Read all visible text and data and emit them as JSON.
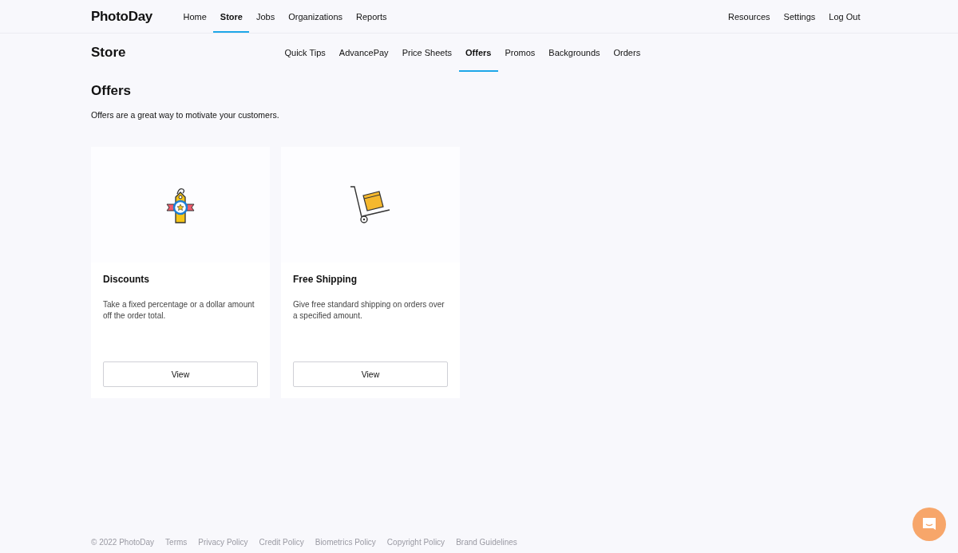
{
  "logo": "PhotoDay",
  "nav": [
    {
      "label": "Home",
      "selected": false
    },
    {
      "label": "Store",
      "selected": true
    },
    {
      "label": "Jobs",
      "selected": false
    },
    {
      "label": "Organizations",
      "selected": false
    },
    {
      "label": "Reports",
      "selected": false
    }
  ],
  "nav_right": [
    "Resources",
    "Settings",
    "Log Out"
  ],
  "section_title": "Store",
  "subnav": [
    {
      "label": "Quick Tips",
      "selected": false
    },
    {
      "label": "AdvancePay",
      "selected": false
    },
    {
      "label": "Price Sheets",
      "selected": false
    },
    {
      "label": "Offers",
      "selected": true
    },
    {
      "label": "Promos",
      "selected": false
    },
    {
      "label": "Backgrounds",
      "selected": false
    },
    {
      "label": "Orders",
      "selected": false
    }
  ],
  "page_title": "Offers",
  "intro": "Offers are a great way to motivate your customers.",
  "cards": [
    {
      "kind": "tag",
      "title": "Discounts",
      "description": "Take a fixed percentage or a dollar amount off the order total.",
      "button": "View"
    },
    {
      "kind": "cart",
      "title": "Free Shipping",
      "description": "Give free standard shipping on orders over a specified amount.",
      "button": "View"
    }
  ],
  "footer": [
    "© 2022 PhotoDay",
    "Terms",
    "Privacy Policy",
    "Credit Policy",
    "Biometrics Policy",
    "Copyright Policy",
    "Brand Guidelines"
  ]
}
